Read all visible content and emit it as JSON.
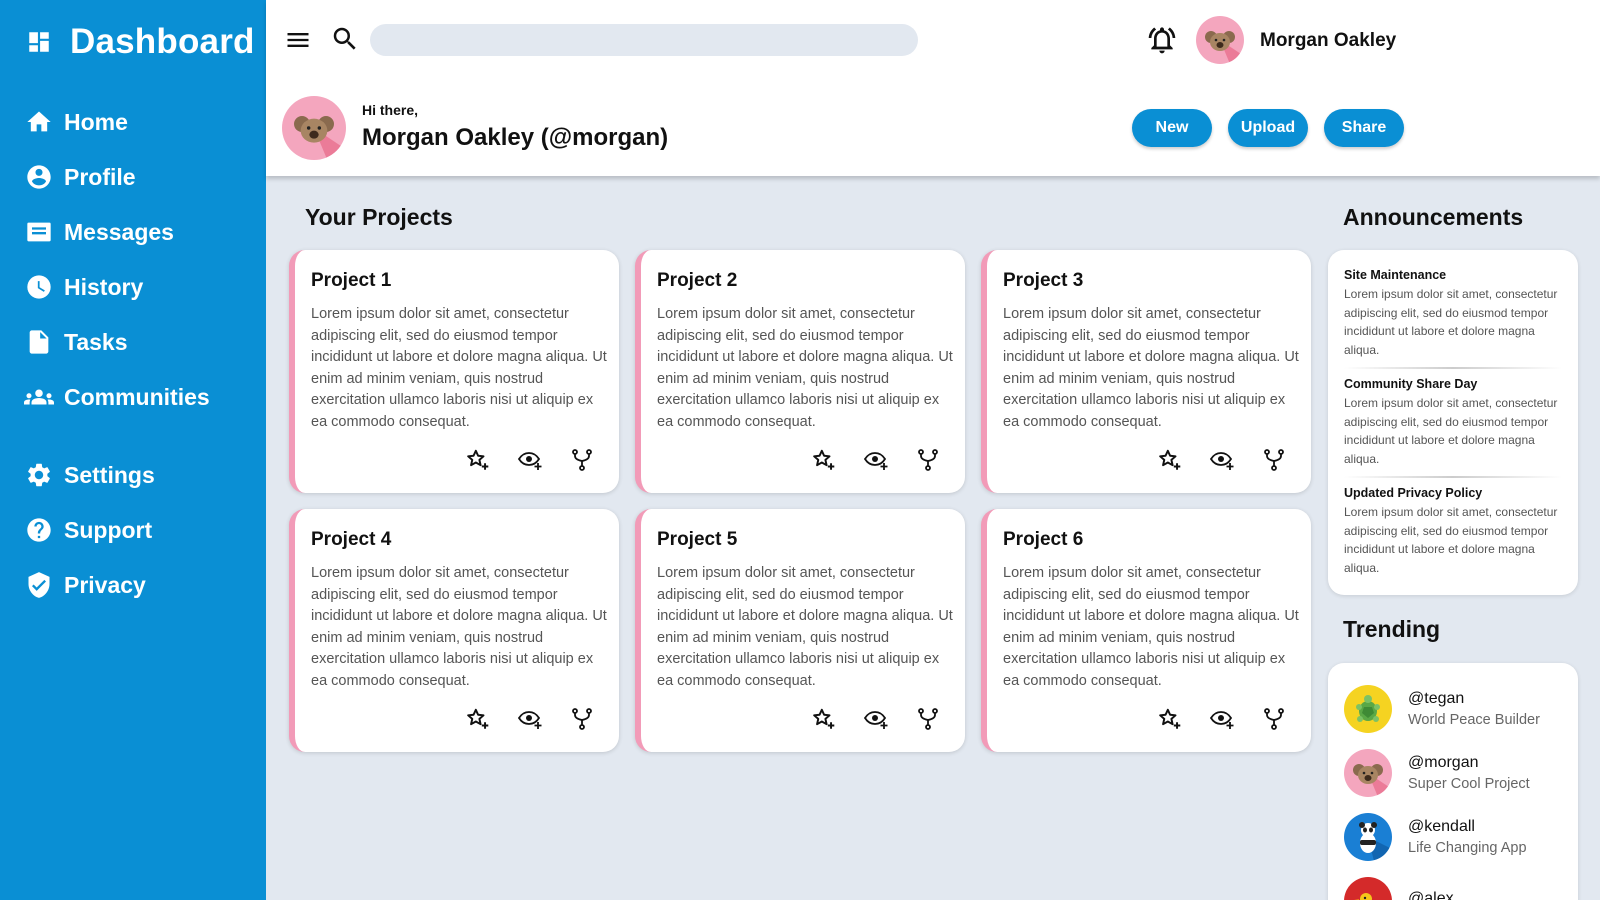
{
  "sidebar": {
    "brand": "Dashboard",
    "items": [
      {
        "label": "Home",
        "icon": "home-icon"
      },
      {
        "label": "Profile",
        "icon": "profile-icon"
      },
      {
        "label": "Messages",
        "icon": "messages-icon"
      },
      {
        "label": "History",
        "icon": "clock-icon"
      },
      {
        "label": "Tasks",
        "icon": "document-icon"
      },
      {
        "label": "Communities",
        "icon": "people-icon"
      },
      {
        "label": "Settings",
        "icon": "gear-icon"
      },
      {
        "label": "Support",
        "icon": "help-icon"
      },
      {
        "label": "Privacy",
        "icon": "shield-icon"
      }
    ]
  },
  "header": {
    "search": {
      "value": "",
      "placeholder": ""
    },
    "username": "Morgan Oakley",
    "greeting": "Hi there,",
    "full_name": "Morgan Oakley (@morgan)",
    "buttons": {
      "new": "New",
      "upload": "Upload",
      "share": "Share"
    }
  },
  "projects": {
    "title": "Your Projects",
    "items": [
      {
        "title": "Project 1",
        "desc": "Lorem ipsum dolor sit amet, consectetur adipiscing elit, sed do eiusmod tempor incididunt ut labore et dolore magna aliqua. Ut enim ad minim veniam, quis nostrud exercitation ullamco laboris nisi ut aliquip ex ea commodo consequat."
      },
      {
        "title": "Project 2",
        "desc": "Lorem ipsum dolor sit amet, consectetur adipiscing elit, sed do eiusmod tempor incididunt ut labore et dolore magna aliqua. Ut enim ad minim veniam, quis nostrud exercitation ullamco laboris nisi ut aliquip ex ea commodo consequat."
      },
      {
        "title": "Project 3",
        "desc": "Lorem ipsum dolor sit amet, consectetur adipiscing elit, sed do eiusmod tempor incididunt ut labore et dolore magna aliqua. Ut enim ad minim veniam, quis nostrud exercitation ullamco laboris nisi ut aliquip ex ea commodo consequat."
      },
      {
        "title": "Project 4",
        "desc": "Lorem ipsum dolor sit amet, consectetur adipiscing elit, sed do eiusmod tempor incididunt ut labore et dolore magna aliqua. Ut enim ad minim veniam, quis nostrud exercitation ullamco laboris nisi ut aliquip ex ea commodo consequat."
      },
      {
        "title": "Project 5",
        "desc": "Lorem ipsum dolor sit amet, consectetur adipiscing elit, sed do eiusmod tempor incididunt ut labore et dolore magna aliqua. Ut enim ad minim veniam, quis nostrud exercitation ullamco laboris nisi ut aliquip ex ea commodo consequat."
      },
      {
        "title": "Project 6",
        "desc": "Lorem ipsum dolor sit amet, consectetur adipiscing elit, sed do eiusmod tempor incididunt ut labore et dolore magna aliqua. Ut enim ad minim veniam, quis nostrud exercitation ullamco laboris nisi ut aliquip ex ea commodo consequat."
      }
    ]
  },
  "announcements": {
    "title": "Announcements",
    "items": [
      {
        "title": "Site Maintenance",
        "body": "Lorem ipsum dolor sit amet, consectetur adipiscing elit, sed do eiusmod tempor incididunt ut labore et dolore magna aliqua."
      },
      {
        "title": "Community Share Day",
        "body": "Lorem ipsum dolor sit amet, consectetur adipiscing elit, sed do eiusmod tempor incididunt ut labore et dolore magna aliqua."
      },
      {
        "title": "Updated Privacy Policy",
        "body": "Lorem ipsum dolor sit amet, consectetur adipiscing elit, sed do eiusmod tempor incididunt ut labore et dolore magna aliqua."
      }
    ]
  },
  "trending": {
    "title": "Trending",
    "items": [
      {
        "handle": "@tegan",
        "project": "World Peace Builder",
        "avatar_color": "#f5d321"
      },
      {
        "handle": "@morgan",
        "project": "Super Cool Project",
        "avatar_color": "#f4a6be"
      },
      {
        "handle": "@kendall",
        "project": "Life Changing App",
        "avatar_color": "#1a7fd4"
      },
      {
        "handle": "@alex",
        "project": "",
        "avatar_color": "#d42a2a"
      }
    ]
  },
  "colors": {
    "sidebar": "#0a8fd4",
    "accent": "#0a8fd4",
    "card_border": "#f29bb8",
    "background": "#e2e8f0"
  }
}
